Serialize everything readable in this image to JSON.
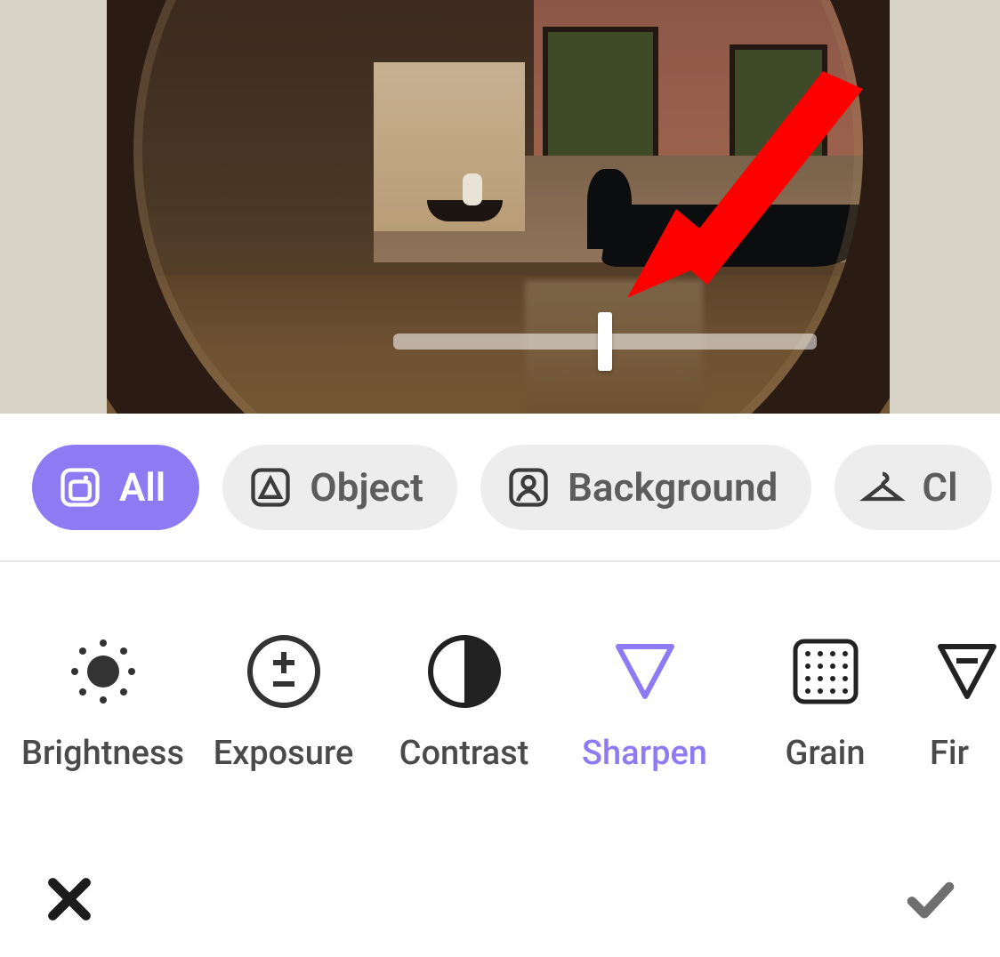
{
  "colors": {
    "accent": "#8e7bf4",
    "pill_bg": "#ededed",
    "text": "#4a4a4a"
  },
  "slider": {
    "value_percent": 50
  },
  "categories": {
    "items": [
      {
        "id": "all",
        "label": "All",
        "icon": "stack-icon",
        "active": true
      },
      {
        "id": "object",
        "label": "Object",
        "icon": "triangle-in-square-icon",
        "active": false
      },
      {
        "id": "background",
        "label": "Background",
        "icon": "person-in-square-icon",
        "active": false
      },
      {
        "id": "clothes",
        "label": "Cl",
        "icon": "hanger-icon",
        "active": false,
        "truncated": true
      }
    ]
  },
  "adjustments": {
    "items": [
      {
        "id": "brightness",
        "label": "Brightness",
        "icon": "brightness-icon",
        "active": false
      },
      {
        "id": "exposure",
        "label": "Exposure",
        "icon": "exposure-icon",
        "active": false
      },
      {
        "id": "contrast",
        "label": "Contrast",
        "icon": "contrast-icon",
        "active": false
      },
      {
        "id": "sharpen",
        "label": "Sharpen",
        "icon": "sharpen-icon",
        "active": true
      },
      {
        "id": "grain",
        "label": "Grain",
        "icon": "grain-icon",
        "active": false
      },
      {
        "id": "fir",
        "label": "Fir",
        "icon": "fine-icon",
        "active": false,
        "truncated": true
      }
    ]
  },
  "bottom": {
    "cancel": "cancel",
    "confirm": "confirm"
  }
}
